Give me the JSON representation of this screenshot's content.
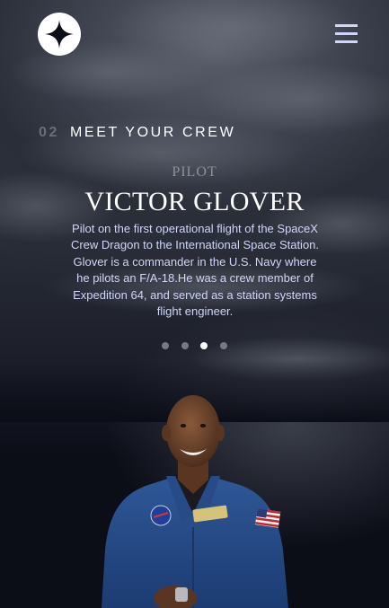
{
  "header": {
    "logo_icon": "four-point-star-icon",
    "menu_icon": "hamburger-menu-icon"
  },
  "section": {
    "number": "02",
    "title": "MEET YOUR CREW"
  },
  "crew": {
    "role": "PILOT",
    "name": "VICTOR GLOVER",
    "bio": "Pilot on the first operational flight of the SpaceX Crew Dragon to the International Space Station. Glover is a commander in the U.S. Navy where he pilots an F/A-18.He was a crew member of Expedition 64, and served as a station systems flight engineer."
  },
  "carousel": {
    "count": 4,
    "active_index": 2
  },
  "colors": {
    "background": "#0b0d17",
    "accent": "#d0d6f9",
    "muted": "#8e9098",
    "white": "#ffffff"
  }
}
